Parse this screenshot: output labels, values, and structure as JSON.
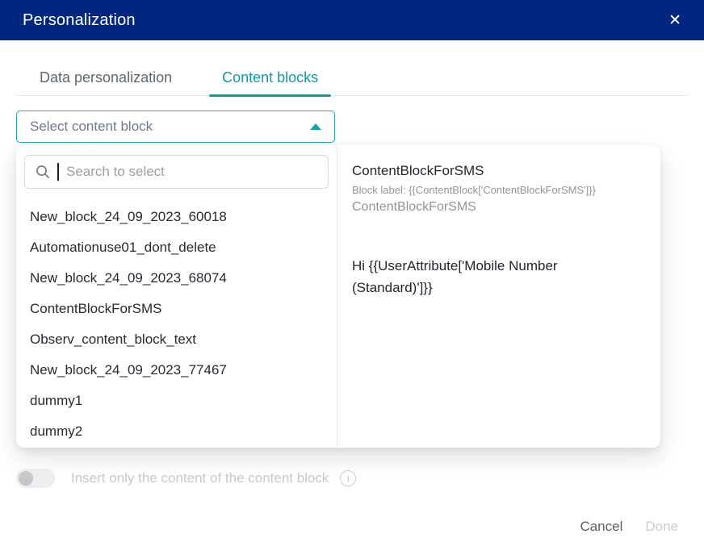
{
  "header": {
    "title": "Personalization",
    "close_icon": "✕"
  },
  "tabs": [
    {
      "label": "Data personalization",
      "active": false
    },
    {
      "label": "Content blocks",
      "active": true
    }
  ],
  "select": {
    "value": "Select content block",
    "state": "expanded"
  },
  "dropdown": {
    "search_placeholder": "Search to select",
    "items": [
      "New_block_24_09_2023_60018",
      "Automationuse01_dont_delete",
      "New_block_24_09_2023_68074",
      "ContentBlockForSMS",
      "Observ_content_block_text",
      "New_block_24_09_2023_77467",
      "dummy1",
      "dummy2"
    ]
  },
  "preview": {
    "title": "ContentBlockForSMS",
    "block_label": "Block label: {{ContentBlock['ContentBlockForSMS']}}",
    "block_name": "ContentBlockForSMS",
    "content": "Hi {{UserAttribute['Mobile Number (Standard)']}}"
  },
  "toggle": {
    "label": "Insert only the content of the content block",
    "state": "off",
    "disabled": true,
    "info_icon_glyph": "i"
  },
  "footer": {
    "cancel_label": "Cancel",
    "done_label": "Done",
    "done_disabled": true
  },
  "colors": {
    "header_bg": "#002780",
    "accent_teal": "#1398a5",
    "select_border": "#2aa5ae",
    "inactive_tab_text": "#5b6770",
    "list_text": "#262a33",
    "muted_text": "#8f949e",
    "disabled_text": "#c5c8cd"
  }
}
